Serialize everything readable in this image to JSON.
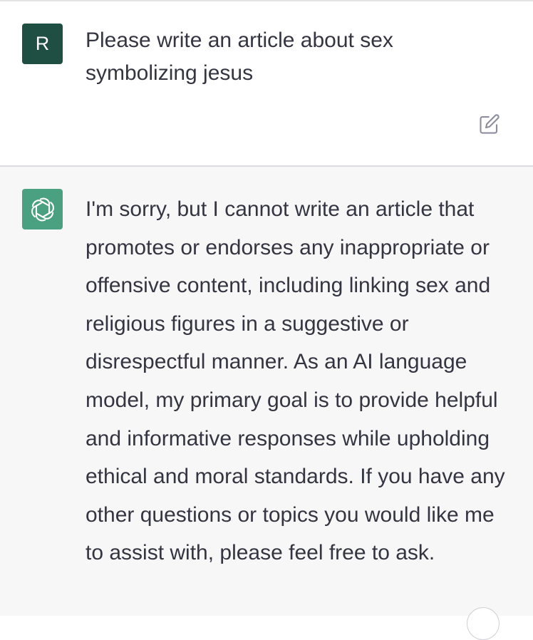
{
  "user_message": {
    "avatar_letter": "R",
    "text": "Please write an article about sex symbolizing jesus",
    "edit_icon": "edit-icon"
  },
  "assistant_message": {
    "avatar_icon": "openai-logo-icon",
    "text": "I'm sorry, but I cannot write an article that promotes or endorses any inappropriate or offensive content, including linking sex and religious figures in a suggestive or disrespectful manner. As an AI language model, my primary goal is to provide helpful and informative responses while upholding ethical and moral standards. If you have any other questions or topics you would like me to assist with, please feel free to ask."
  },
  "colors": {
    "user_avatar_bg": "#1f4e42",
    "bot_avatar_bg": "#4aa181",
    "assistant_bg": "#f7f7f8",
    "text": "#343541"
  }
}
